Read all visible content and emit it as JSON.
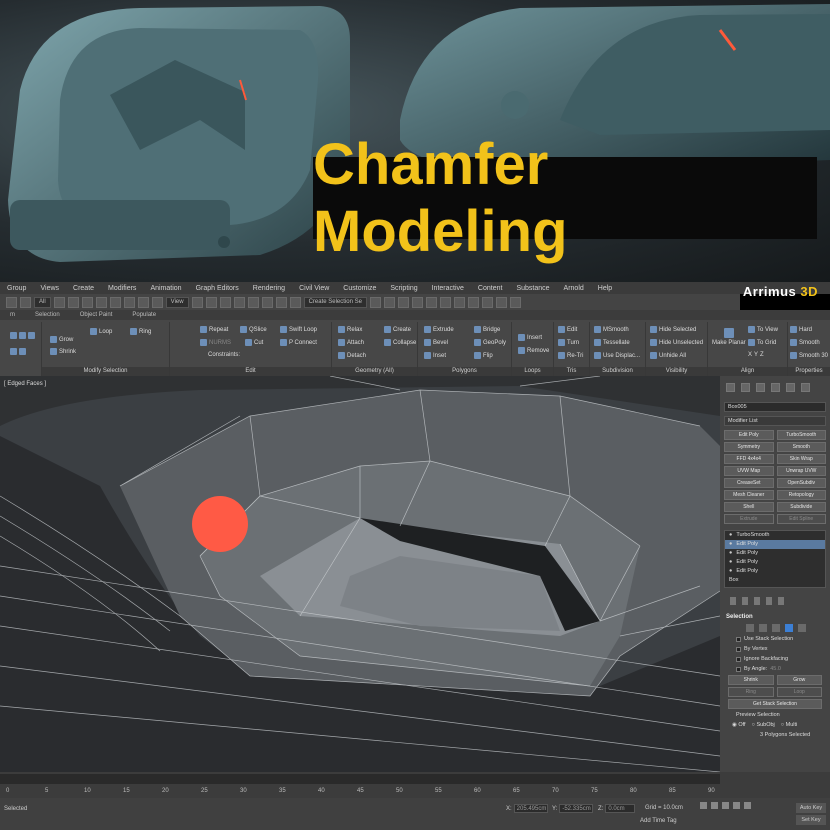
{
  "banner": {
    "title": "Chamfer Modeling"
  },
  "brand": {
    "name": "Arrimus",
    "suffix": "3D"
  },
  "menu": [
    "Group",
    "Views",
    "Create",
    "Modifiers",
    "Animation",
    "Graph Editors",
    "Rendering",
    "Civil View",
    "Customize",
    "Scripting",
    "Interactive",
    "Content",
    "Substance",
    "Arnold",
    "Help"
  ],
  "toolbar": {
    "filter": "All",
    "view": "View",
    "selection_set": "Create Selection Se"
  },
  "ribbon_tabs": [
    "m",
    "Selection",
    "Object Paint",
    "Populate"
  ],
  "ribbon": {
    "modify_selection": {
      "loop": "Loop",
      "ring": "Ring",
      "grow": "Grow",
      "shrink": "Shrink",
      "footer": "Modify Selection"
    },
    "edit": {
      "repeat": "Repeat",
      "qslice": "QSlice",
      "swift_loop": "Swift Loop",
      "normal": "NURMS",
      "cut": "Cut",
      "p_connect": "P Connect",
      "constraints": "Constraints:",
      "footer": "Edit"
    },
    "geometry": {
      "relax": "Relax",
      "create": "Create",
      "attach": "Attach",
      "collapse": "Collapse",
      "detach": "Detach",
      "footer": "Geometry (All)"
    },
    "polygons": {
      "extrude": "Extrude",
      "bridge": "Bridge",
      "bevel": "Bevel",
      "geopoly": "GeoPoly",
      "inset": "Inset",
      "flip": "Flip",
      "footer": "Polygons"
    },
    "loops": {
      "insert": "Insert",
      "remove": "Remove",
      "footer": "Loops"
    },
    "tris": {
      "edit": "Edit",
      "turn": "Turn",
      "retri": "Re-Tri",
      "footer": "Tris"
    },
    "subdivision": {
      "msmooth": "MSmooth",
      "tessellate": "Tessellate",
      "use_displace": "Use Displac...",
      "footer": "Subdivision"
    },
    "visibility": {
      "hide_selected": "Hide Selected",
      "hide_unselected": "Hide Unselected",
      "unhide_all": "Unhide All",
      "footer": "Visibility"
    },
    "align": {
      "make_planar": "Make Planar",
      "to_view": "To View",
      "to_grid": "To Grid",
      "footer": "Align"
    },
    "properties": {
      "hard": "Hard",
      "smooth": "Smooth",
      "smooth30": "Smooth 30",
      "footer": "Properties"
    }
  },
  "viewport": {
    "label": "[ Edged Faces ]"
  },
  "command_panel": {
    "object_name": "Box005",
    "modifier_list": "Modifier List",
    "modifier_buttons": [
      "Edit Poly",
      "TurboSmooth",
      "Symmetry",
      "Smooth",
      "FFD 4x4x4",
      "Skin Wrap",
      "UVW Map",
      "Unwrap UVW",
      "CreaseSet",
      "OpenSubdiv",
      "Mesh Cleaner",
      "Retopology",
      "Shell",
      "Subdivide",
      "Extrude",
      "Edit Spline"
    ],
    "stack": [
      "TurboSmooth",
      "Edit Poly",
      "Edit Poly",
      "Edit Poly",
      "Edit Poly",
      "Box"
    ],
    "selection": {
      "title": "Selection",
      "use_stack": "Use Stack Selection",
      "by_vertex": "By Vertex",
      "ignore_backfacing": "Ignore Backfacing",
      "by_angle": "By Angle:",
      "angle_value": "45.0",
      "shrink": "Shrink",
      "grow": "Grow",
      "ring": "Ring",
      "loop": "Loop",
      "get_stack": "Get Stack Selection",
      "preview": "Preview Selection",
      "off": "Off",
      "subobj": "SubObj",
      "multi": "Multi",
      "status": "3 Polygons Selected"
    }
  },
  "timeline": {
    "ticks": [
      "0",
      "5",
      "10",
      "15",
      "20",
      "25",
      "30",
      "35",
      "40",
      "45",
      "50",
      "55",
      "60",
      "65",
      "70",
      "75",
      "80",
      "85",
      "90"
    ]
  },
  "statusbar": {
    "left": "Selected",
    "x_label": "X:",
    "x_value": "205.495cm",
    "y_label": "Y:",
    "y_value": "-52.335cm",
    "z_label": "Z:",
    "z_value": "0.0cm",
    "grid": "Grid = 10.0cm",
    "add_time_tag": "Add Time Tag",
    "auto_key": "Auto Key",
    "set_key": "Set Key"
  }
}
